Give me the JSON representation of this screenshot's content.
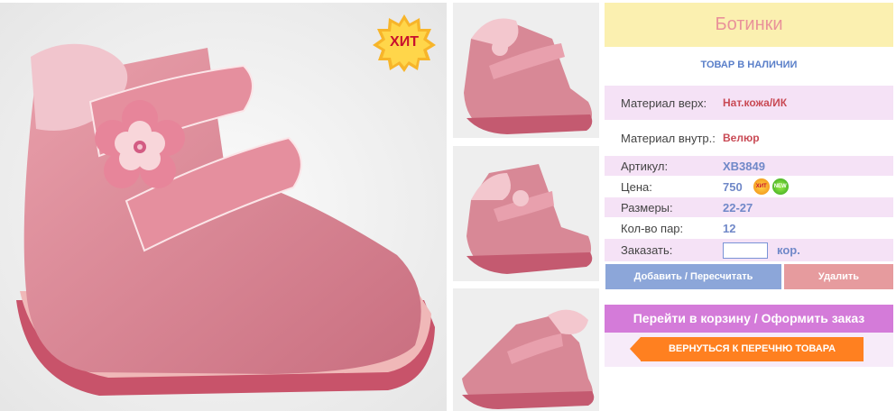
{
  "product": {
    "title": "Ботинки",
    "stock_status": "ТОВАР В НАЛИЧИИ",
    "hit_badge": "ХИТ",
    "specs": [
      {
        "label": "Материал верх:",
        "value": "Нат.кожа/ИК"
      },
      {
        "label": "Материал внутр.:",
        "value": "Велюр"
      },
      {
        "label": "Артикул:",
        "value": "ХВ3849"
      },
      {
        "label": "Цена:",
        "value": "750"
      },
      {
        "label": "Размеры:",
        "value": "22-27"
      },
      {
        "label": "Кол-во пар:",
        "value": "12"
      }
    ],
    "price_badges": {
      "hit": "ХИТ",
      "new": "NEW"
    },
    "order": {
      "label": "Заказать:",
      "value": "",
      "unit": "кор."
    }
  },
  "actions": {
    "add": "Добавить / Пересчитать",
    "delete": "Удалить",
    "cart": "Перейти в корзину / Оформить заказ",
    "back": "ВЕРНУТЬСЯ К ПЕРЕЧНЮ ТОВАРА"
  },
  "icons": {
    "hit_star": "starburst-badge-icon",
    "back_arrow": "left-arrow-icon"
  },
  "colors": {
    "title_bg": "#fbf0b0",
    "title_text": "#e9929a",
    "add_button": "#8ca6d9",
    "delete_button": "#e69b9e",
    "cart_button": "#d47bd9",
    "back_button": "#ff8020",
    "row_highlight": "#f5e2f6"
  }
}
